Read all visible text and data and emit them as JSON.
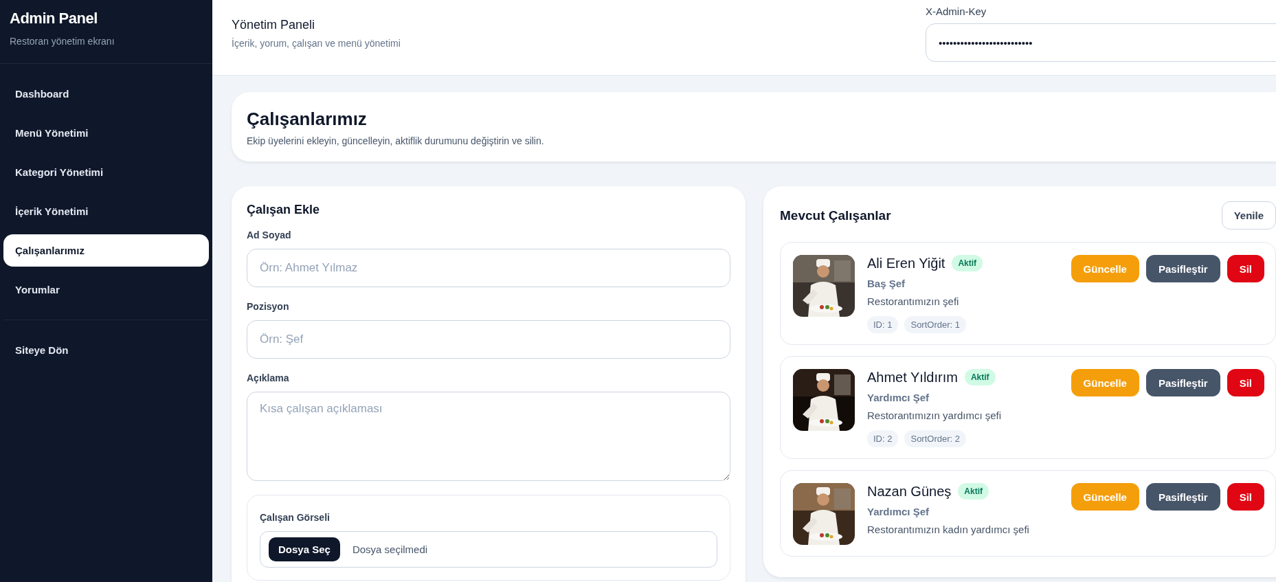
{
  "sidebar": {
    "title": "Admin Panel",
    "subtitle": "Restoran yönetim ekranı",
    "items": [
      {
        "label": "Dashboard",
        "selected": false
      },
      {
        "label": "Menü Yönetimi",
        "selected": false
      },
      {
        "label": "Kategori Yönetimi",
        "selected": false
      },
      {
        "label": "İçerik Yönetimi",
        "selected": false
      },
      {
        "label": "Çalışanlarımız",
        "selected": true
      },
      {
        "label": "Yorumlar",
        "selected": false
      }
    ],
    "footer_items": [
      {
        "label": "Siteye Dön",
        "selected": false
      }
    ]
  },
  "header": {
    "title": "Yönetim Paneli",
    "subtitle": "İçerik, yorum, çalışan ve menü yönetimi",
    "key_field": {
      "label": "X-Admin-Key",
      "value": "••••••••••••••••••••••••••"
    }
  },
  "intro": {
    "title": "Çalışanlarımız",
    "subtitle": "Ekip üyelerini ekleyin, güncelleyin, aktiflik durumunu değiştirin ve silin."
  },
  "form": {
    "title": "Çalışan Ekle",
    "fields": [
      {
        "kind": "text",
        "label": "Ad Soyad",
        "placeholder": "Örn: Ahmet Yılmaz"
      },
      {
        "kind": "text",
        "label": "Pozisyon",
        "placeholder": "Örn: Şef"
      },
      {
        "kind": "textarea",
        "label": "Açıklama",
        "placeholder": "Kısa çalışan açıklaması"
      }
    ],
    "image": {
      "label": "Çalışan Görseli",
      "button": "Dosya Seç",
      "status": "Dosya seçilmedi"
    }
  },
  "list": {
    "title": "Mevcut Çalışanlar",
    "refresh": "Yenile",
    "employees": [
      {
        "name": "Ali Eren Yiğit",
        "status": "Aktif",
        "active": true,
        "position": "Baş Şef",
        "description": "Restorantımızın şefi",
        "id": "ID: 1",
        "sort": "SortOrder: 1",
        "actions": [
          {
            "kind": "edit",
            "label": "Güncelle"
          },
          {
            "kind": "toggle",
            "label": "Pasifleştir"
          },
          {
            "kind": "delete",
            "label": "Sil"
          }
        ]
      },
      {
        "name": "Ahmet Yıldırım",
        "status": "Aktif",
        "active": true,
        "position": "Yardımcı Şef",
        "description": "Restorantımızın yardımcı şefi",
        "id": "ID: 2",
        "sort": "SortOrder: 2",
        "actions": [
          {
            "kind": "edit",
            "label": "Güncelle"
          },
          {
            "kind": "toggle",
            "label": "Pasifleştir"
          },
          {
            "kind": "delete",
            "label": "Sil"
          }
        ]
      },
      {
        "name": "Nazan Güneş",
        "status": "Aktif",
        "active": true,
        "position": "Yardımcı Şef",
        "description": "Restorantımızın kadın yardımcı şefi",
        "actions": [
          {
            "kind": "edit",
            "label": "Güncelle"
          },
          {
            "kind": "toggle",
            "label": "Pasifleştir"
          },
          {
            "kind": "delete",
            "label": "Sil"
          }
        ]
      }
    ]
  }
}
